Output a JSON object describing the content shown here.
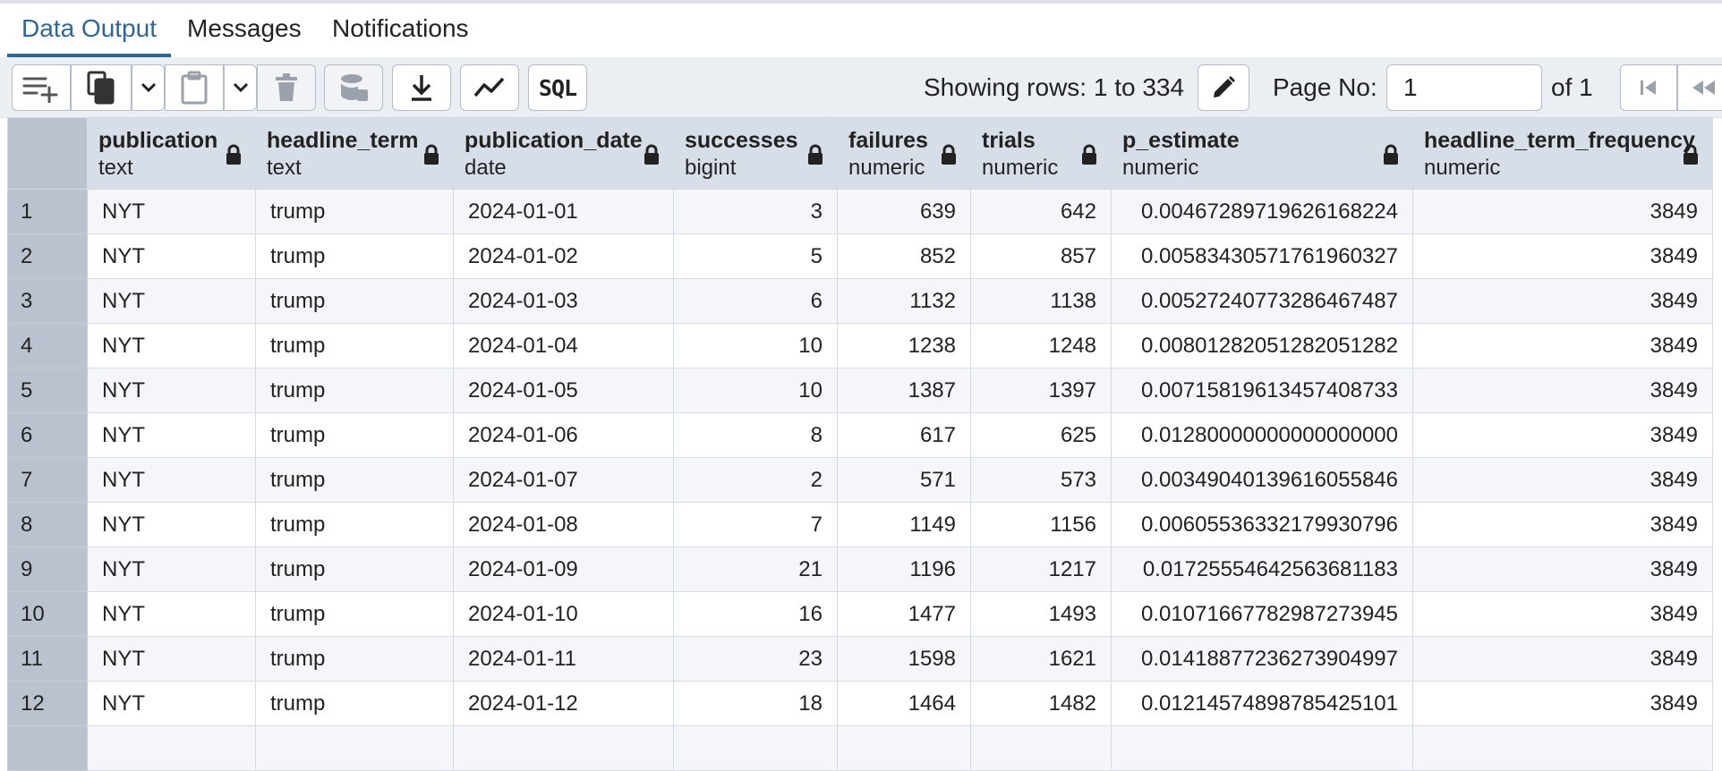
{
  "tabs": [
    {
      "label": "Data Output",
      "active": true
    },
    {
      "label": "Messages",
      "active": false
    },
    {
      "label": "Notifications",
      "active": false
    }
  ],
  "toolbar": {
    "rows_info": "Showing rows: 1 to 334",
    "page_label": "Page No:",
    "page_value": "1",
    "page_of": "of 1",
    "sql_label": "SQL"
  },
  "columns": [
    {
      "name": "publication",
      "type": "text"
    },
    {
      "name": "headline_term",
      "type": "text"
    },
    {
      "name": "publication_date",
      "type": "date"
    },
    {
      "name": "successes",
      "type": "bigint"
    },
    {
      "name": "failures",
      "type": "numeric"
    },
    {
      "name": "trials",
      "type": "numeric"
    },
    {
      "name": "p_estimate",
      "type": "numeric"
    },
    {
      "name": "headline_term_frequency",
      "type": "numeric"
    }
  ],
  "rows": [
    [
      "1",
      "NYT",
      "trump",
      "2024-01-01",
      "3",
      "639",
      "642",
      "0.00467289719626168224",
      "3849"
    ],
    [
      "2",
      "NYT",
      "trump",
      "2024-01-02",
      "5",
      "852",
      "857",
      "0.00583430571761960327",
      "3849"
    ],
    [
      "3",
      "NYT",
      "trump",
      "2024-01-03",
      "6",
      "1132",
      "1138",
      "0.00527240773286467487",
      "3849"
    ],
    [
      "4",
      "NYT",
      "trump",
      "2024-01-04",
      "10",
      "1238",
      "1248",
      "0.00801282051282051282",
      "3849"
    ],
    [
      "5",
      "NYT",
      "trump",
      "2024-01-05",
      "10",
      "1387",
      "1397",
      "0.00715819613457408733",
      "3849"
    ],
    [
      "6",
      "NYT",
      "trump",
      "2024-01-06",
      "8",
      "617",
      "625",
      "0.01280000000000000000",
      "3849"
    ],
    [
      "7",
      "NYT",
      "trump",
      "2024-01-07",
      "2",
      "571",
      "573",
      "0.00349040139616055846",
      "3849"
    ],
    [
      "8",
      "NYT",
      "trump",
      "2024-01-08",
      "7",
      "1149",
      "1156",
      "0.00605536332179930796",
      "3849"
    ],
    [
      "9",
      "NYT",
      "trump",
      "2024-01-09",
      "21",
      "1196",
      "1217",
      "0.01725554642563681183",
      "3849"
    ],
    [
      "10",
      "NYT",
      "trump",
      "2024-01-10",
      "16",
      "1477",
      "1493",
      "0.01071667782987273945",
      "3849"
    ],
    [
      "11",
      "NYT",
      "trump",
      "2024-01-11",
      "23",
      "1598",
      "1621",
      "0.01418877236273904997",
      "3849"
    ],
    [
      "12",
      "NYT",
      "trump",
      "2024-01-12",
      "18",
      "1464",
      "1482",
      "0.01214574898785425101",
      "3849"
    ],
    [
      "",
      "",
      "",
      "",
      "",
      "",
      "",
      "",
      ""
    ]
  ],
  "colors": {
    "accent": "#326690",
    "header_bg": "#d8dee8",
    "rownum_bg": "#bac2d0",
    "toolbar_bg": "#ebeef3"
  }
}
